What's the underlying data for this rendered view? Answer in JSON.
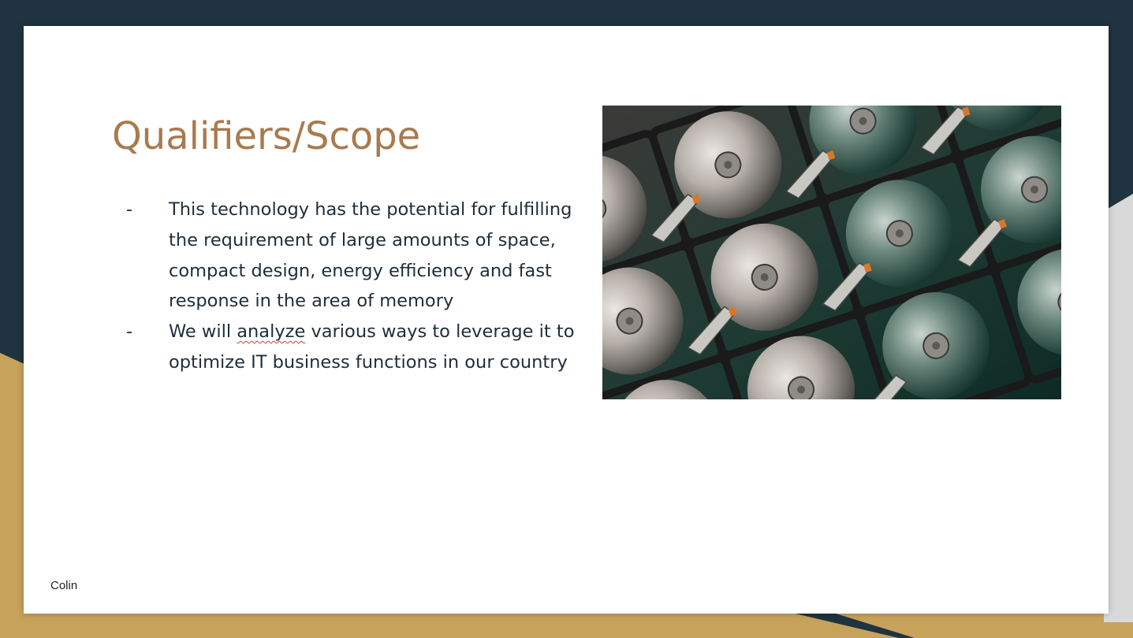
{
  "slide": {
    "title": "Qualifiers/Scope",
    "bullets": [
      {
        "marker": "-",
        "text": "This technology has the potential for fulfilling the requirement of large amounts of space, compact design, energy efficiency and fast response in the area of memory"
      },
      {
        "marker": "-",
        "pre": "We will ",
        "flagged_word": "analyze",
        "post": " various ways to leverage it to optimize IT business functions in our country"
      }
    ],
    "footer": "Colin",
    "image": {
      "icon": "hard-drive-platters-photo"
    }
  },
  "colors": {
    "background_dark": "#1f3440",
    "accent_gold": "#c7a25b",
    "title": "#a97a4f",
    "body_text": "#1f2e3a",
    "spellcheck_underline": "#d23c3c"
  }
}
